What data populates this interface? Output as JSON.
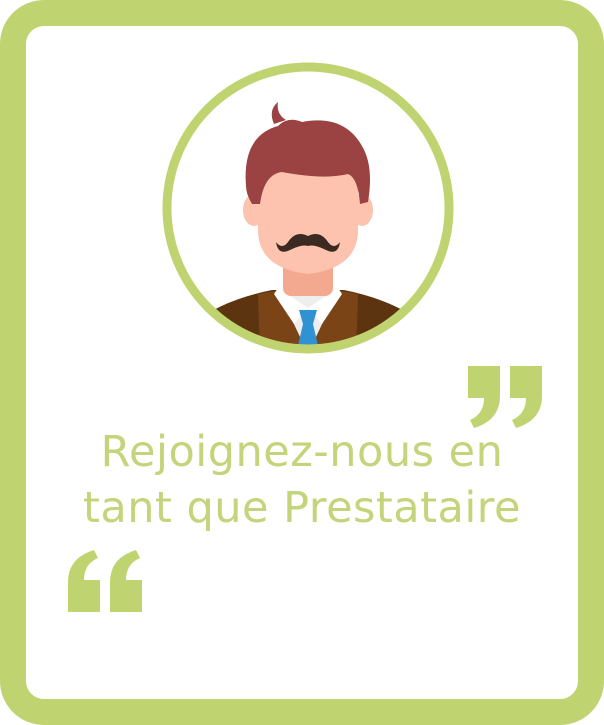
{
  "headline": {
    "line1": "Rejoignez-nous en",
    "line2": "tant que Prestataire"
  },
  "icons": {
    "avatar": "businessman-avatar-icon",
    "quote_open": "quote-open-icon",
    "quote_close": "quote-close-icon"
  },
  "colors": {
    "accent": "#bfd470",
    "text": "#c3d47a",
    "hair": "#9b4242",
    "skin": "#fdc3ae",
    "suit": "#6e3d12",
    "tie": "#2f93d3"
  }
}
